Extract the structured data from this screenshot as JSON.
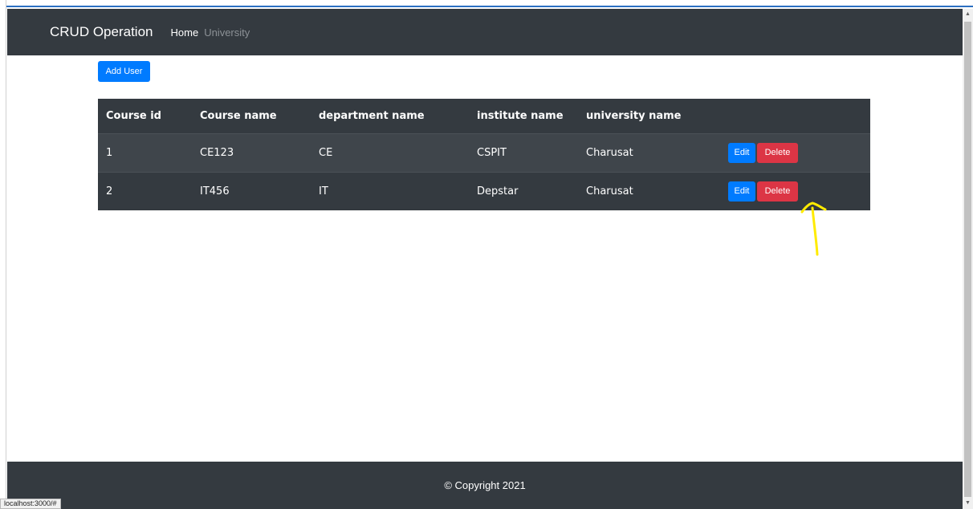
{
  "navbar": {
    "brand": "CRUD Operation",
    "links": [
      {
        "label": "Home",
        "active": true
      },
      {
        "label": "University",
        "active": false
      }
    ]
  },
  "toolbar": {
    "add_user_label": "Add User"
  },
  "table": {
    "headers": [
      "Course id",
      "Course name",
      "department name",
      "institute name",
      "university name"
    ],
    "rows": [
      {
        "id": "1",
        "course": "CE123",
        "department": "CE",
        "institute": "CSPIT",
        "university": "Charusat"
      },
      {
        "id": "2",
        "course": "IT456",
        "department": "IT",
        "institute": "Depstar",
        "university": "Charusat"
      }
    ],
    "edit_label": "Edit",
    "delete_label": "Delete"
  },
  "footer": {
    "copyright": "© Copyright 2021"
  },
  "status_bar": {
    "url": "localhost:3000/#"
  },
  "colors": {
    "navbar_bg": "#343a40",
    "primary": "#007bff",
    "danger": "#dc3545",
    "annotation": "#ffeb00"
  }
}
